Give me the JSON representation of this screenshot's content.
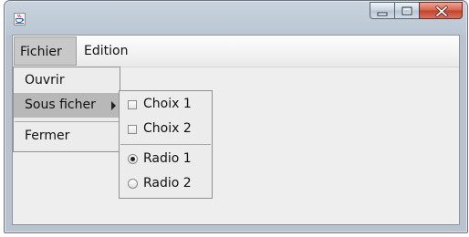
{
  "window": {
    "title": "",
    "app_icon": "java-cup-icon",
    "caption_buttons": [
      "minimize-icon",
      "maximize-icon",
      "close-icon"
    ]
  },
  "menubar": {
    "menus": [
      {
        "label": "Fichier",
        "open": true
      },
      {
        "label": "Edition",
        "open": false
      }
    ]
  },
  "fichier_menu": {
    "items": [
      {
        "label": "Ouvrir",
        "type": "item"
      },
      {
        "label": "Sous ficher",
        "type": "submenu",
        "selected": true,
        "icon": "submenu-arrow-icon"
      },
      {
        "label": "Fermer",
        "type": "item"
      }
    ]
  },
  "sous_ficher_menu": {
    "checkboxes": [
      {
        "label": "Choix 1",
        "checked": false
      },
      {
        "label": "Choix 2",
        "checked": false
      }
    ],
    "radios": [
      {
        "label": "Radio 1",
        "selected": true
      },
      {
        "label": "Radio 2",
        "selected": false
      }
    ]
  },
  "colors": {
    "selected_menu_bg": "#c8c8c8",
    "highlight_item_bg": "#b8b8b8",
    "close_button": "#c4412b"
  }
}
